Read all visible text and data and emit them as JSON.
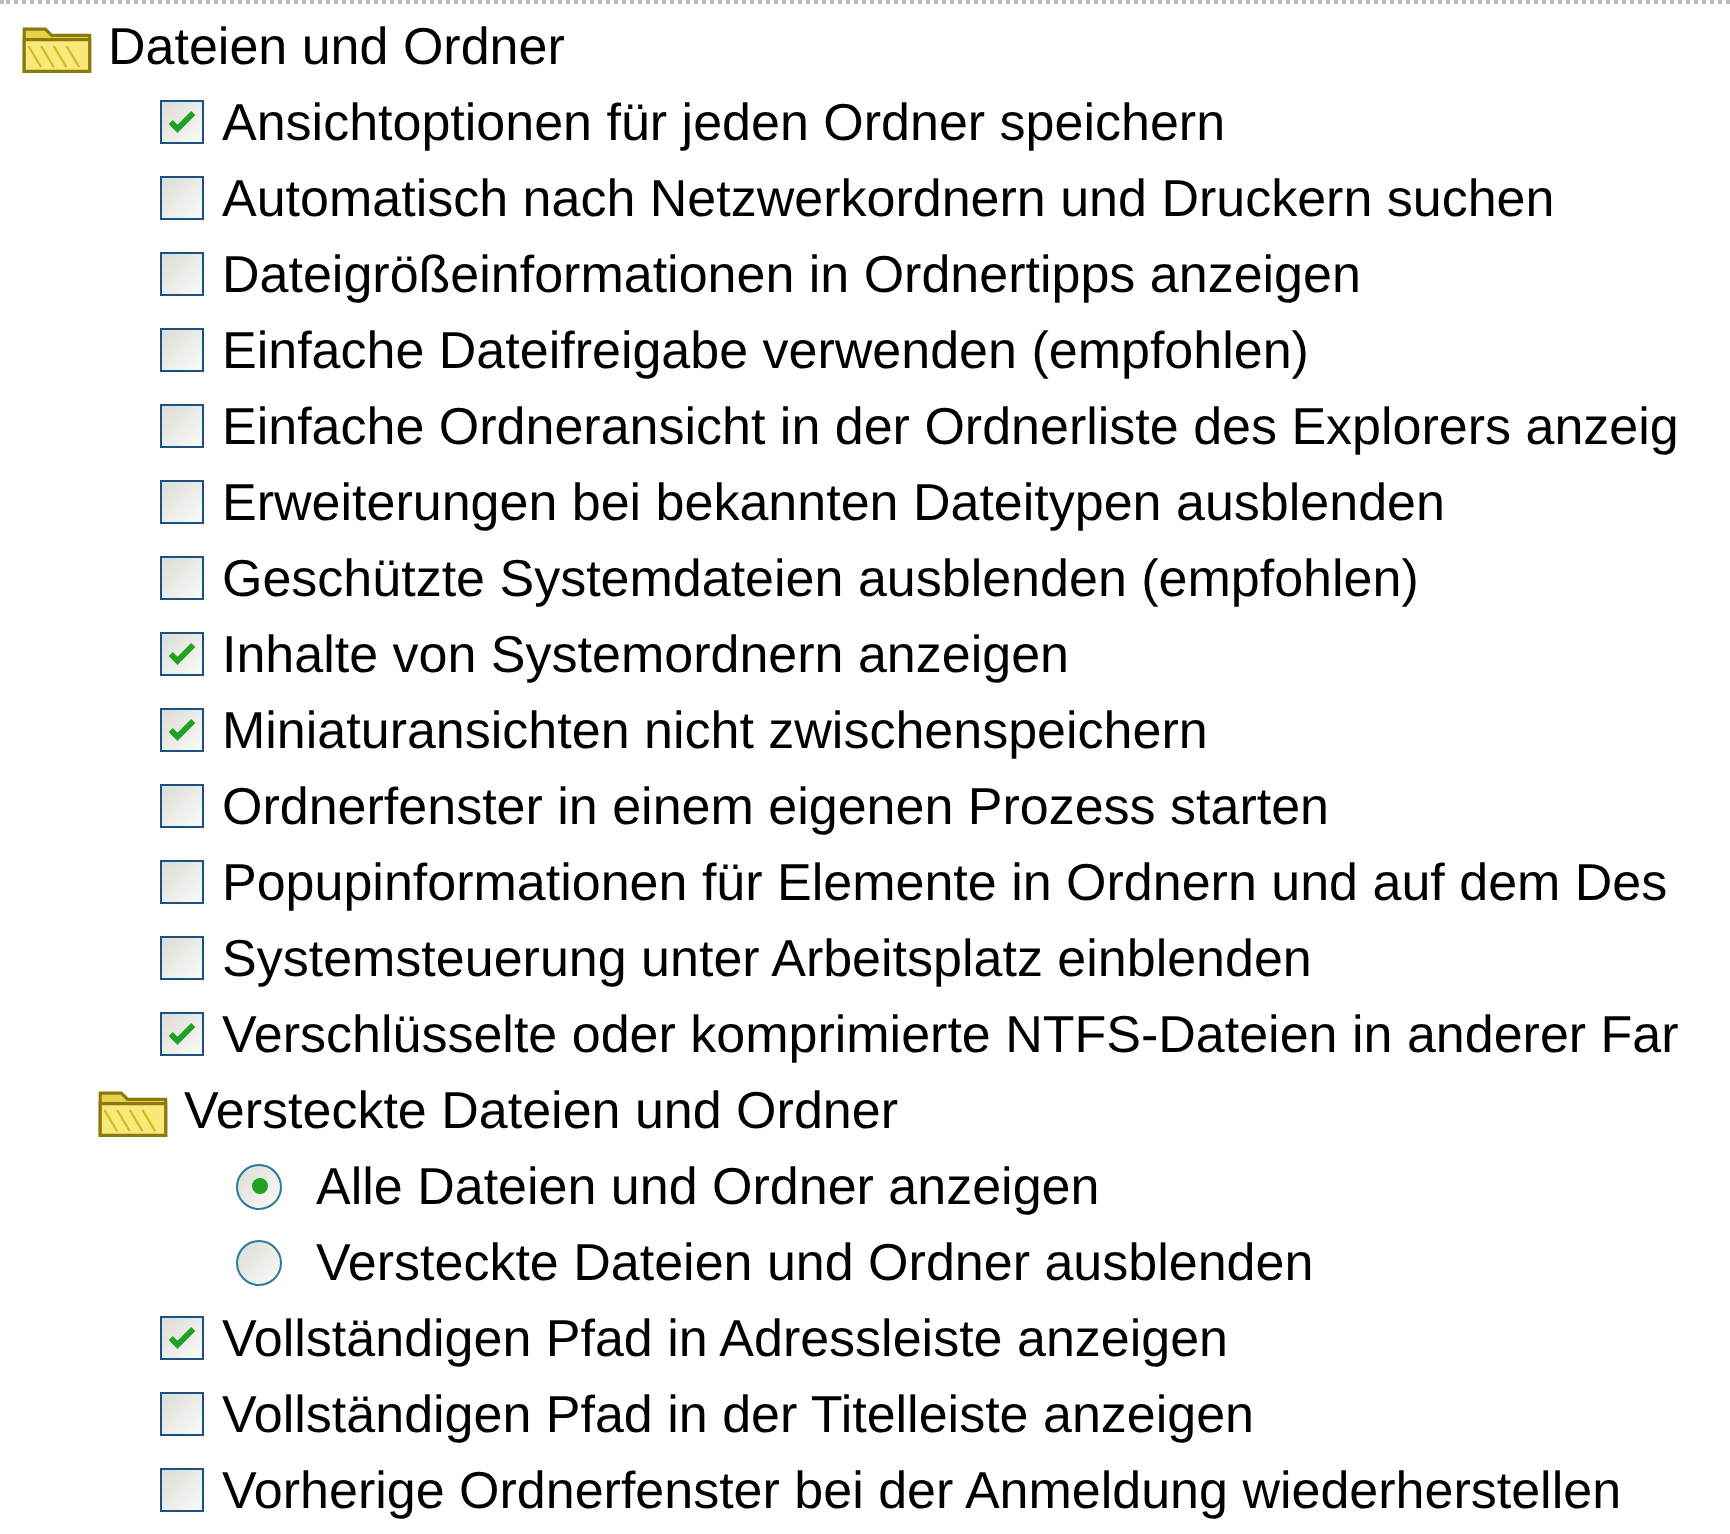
{
  "tree": [
    {
      "kind": "group",
      "label": "Dateien und Ordner",
      "children": [
        {
          "kind": "checkbox",
          "label": "Ansichtoptionen für jeden Ordner speichern",
          "checked": true
        },
        {
          "kind": "checkbox",
          "label": "Automatisch nach Netzwerkordnern und Druckern suchen",
          "checked": false
        },
        {
          "kind": "checkbox",
          "label": "Dateigrößeinformationen in Ordnertipps anzeigen",
          "checked": false
        },
        {
          "kind": "checkbox",
          "label": "Einfache Dateifreigabe verwenden (empfohlen)",
          "checked": false
        },
        {
          "kind": "checkbox",
          "label": "Einfache Ordneransicht in der Ordnerliste des Explorers anzeig",
          "checked": false
        },
        {
          "kind": "checkbox",
          "label": "Erweiterungen bei bekannten Dateitypen ausblenden",
          "checked": false
        },
        {
          "kind": "checkbox",
          "label": "Geschützte Systemdateien ausblenden (empfohlen)",
          "checked": false
        },
        {
          "kind": "checkbox",
          "label": "Inhalte von Systemordnern anzeigen",
          "checked": true
        },
        {
          "kind": "checkbox",
          "label": "Miniaturansichten nicht zwischenspeichern",
          "checked": true
        },
        {
          "kind": "checkbox",
          "label": "Ordnerfenster in einem eigenen Prozess starten",
          "checked": false
        },
        {
          "kind": "checkbox",
          "label": "Popupinformationen für Elemente in Ordnern und auf dem Des",
          "checked": false
        },
        {
          "kind": "checkbox",
          "label": "Systemsteuerung unter Arbeitsplatz einblenden",
          "checked": false
        },
        {
          "kind": "checkbox",
          "label": "Verschlüsselte oder komprimierte NTFS-Dateien in anderer Far",
          "checked": true
        },
        {
          "kind": "group",
          "label": "Versteckte Dateien und Ordner",
          "children": [
            {
              "kind": "radio",
              "label": "Alle Dateien und Ordner anzeigen",
              "selected": true
            },
            {
              "kind": "radio",
              "label": "Versteckte Dateien und Ordner ausblenden",
              "selected": false
            }
          ]
        },
        {
          "kind": "checkbox",
          "label": "Vollständigen Pfad in Adressleiste anzeigen",
          "checked": true
        },
        {
          "kind": "checkbox",
          "label": "Vollständigen Pfad in der Titelleiste anzeigen",
          "checked": false
        },
        {
          "kind": "checkbox",
          "label": "Vorherige Ordnerfenster bei der Anmeldung wiederherstellen",
          "checked": false
        }
      ]
    }
  ]
}
